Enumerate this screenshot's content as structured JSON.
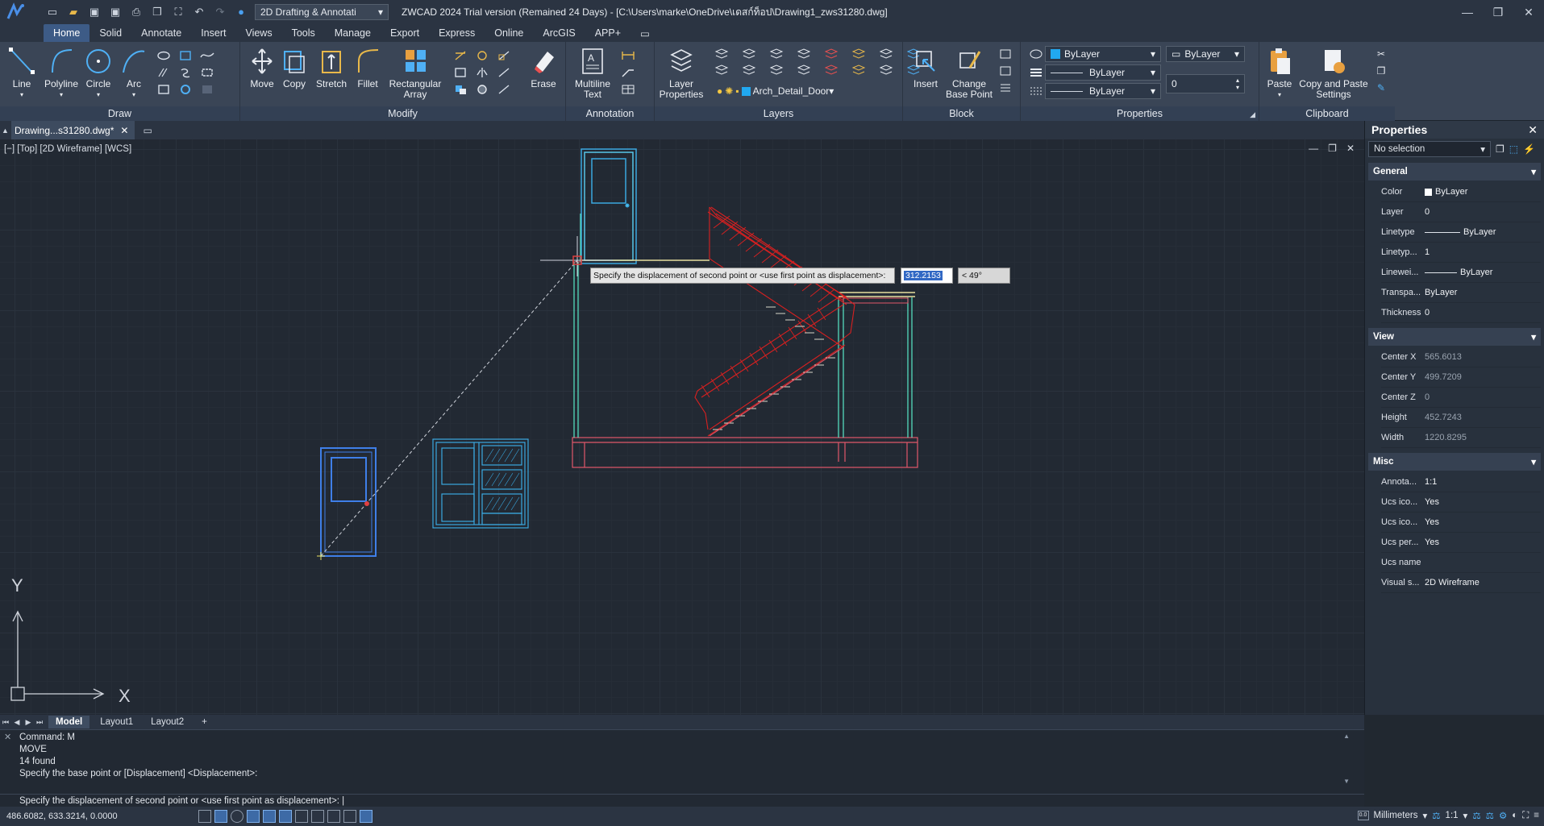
{
  "titlebar": {
    "workspace": "2D Drafting & Annotati",
    "title": "ZWCAD 2024 Trial version (Remained 24 Days) - [C:\\Users\\marke\\OneDrive\\เดสก์ท็อป\\Drawing1_zws31280.dwg]"
  },
  "ribbon_tabs": [
    "Home",
    "Solid",
    "Annotate",
    "Insert",
    "Views",
    "Tools",
    "Manage",
    "Export",
    "Express",
    "Online",
    "ArcGIS",
    "APP+"
  ],
  "ribbon": {
    "draw": {
      "title": "Draw",
      "line": "Line",
      "polyline": "Polyline",
      "circle": "Circle",
      "arc": "Arc"
    },
    "modify": {
      "title": "Modify",
      "move": "Move",
      "copy": "Copy",
      "stretch": "Stretch",
      "fillet": "Fillet",
      "rect_array_1": "Rectangular",
      "rect_array_2": "Array",
      "erase": "Erase"
    },
    "annotation": {
      "title": "Annotation",
      "mtext_1": "Multiline",
      "mtext_2": "Text"
    },
    "layers": {
      "title": "Layers",
      "props_1": "Layer",
      "props_2": "Properties",
      "current_layer": "Arch_Detail_Door"
    },
    "block": {
      "title": "Block",
      "insert": "Insert",
      "change_1": "Change",
      "change_2": "Base Point"
    },
    "properties": {
      "title": "Properties",
      "color": "ByLayer",
      "linetype": "ByLayer",
      "lineweight": "ByLayer",
      "plotstyle": "ByLayer",
      "transparency": "0"
    },
    "clipboard": {
      "title": "Clipboard",
      "paste": "Paste",
      "cps_1": "Copy and Paste",
      "cps_2": "Settings"
    }
  },
  "doc_tab": "Drawing...s31280.dwg*",
  "viewport": {
    "label": "[−] [Top] [2D Wireframe] [WCS]",
    "tooltip": "Specify the displacement of second point or <use first point as displacement>:",
    "distance": "312.2153",
    "angle": "< 49°",
    "ucs_y": "Y",
    "ucs_x": "X"
  },
  "properties_panel": {
    "title": "Properties",
    "selection": "No selection",
    "general": {
      "title": "General",
      "rows": [
        {
          "k": "Color",
          "v": "ByLayer"
        },
        {
          "k": "Layer",
          "v": "0"
        },
        {
          "k": "Linetype",
          "v": "ByLayer"
        },
        {
          "k": "Linetyp...",
          "v": "1"
        },
        {
          "k": "Linewei...",
          "v": "ByLayer"
        },
        {
          "k": "Transpa...",
          "v": "ByLayer"
        },
        {
          "k": "Thickness",
          "v": "0"
        }
      ]
    },
    "view": {
      "title": "View",
      "rows": [
        {
          "k": "Center X",
          "v": "565.6013"
        },
        {
          "k": "Center Y",
          "v": "499.7209"
        },
        {
          "k": "Center Z",
          "v": "0"
        },
        {
          "k": "Height",
          "v": "452.7243"
        },
        {
          "k": "Width",
          "v": "1220.8295"
        }
      ]
    },
    "misc": {
      "title": "Misc",
      "rows": [
        {
          "k": "Annota...",
          "v": "1:1"
        },
        {
          "k": "Ucs ico...",
          "v": "Yes"
        },
        {
          "k": "Ucs ico...",
          "v": "Yes"
        },
        {
          "k": "Ucs per...",
          "v": "Yes"
        },
        {
          "k": "Ucs name",
          "v": ""
        },
        {
          "k": "Visual s...",
          "v": "2D Wireframe"
        }
      ]
    }
  },
  "layout_tabs": [
    "Model",
    "Layout1",
    "Layout2",
    "+"
  ],
  "command": {
    "history": [
      "Command: M",
      "MOVE",
      "14 found",
      "Specify the base point or [Displacement] <Displacement>:"
    ],
    "prompt": "Specify the displacement of second point or <use first point as displacement>: |"
  },
  "status": {
    "coords": "486.6082, 633.3214, 0.0000",
    "units": "Millimeters",
    "scale": "1:1"
  },
  "colors": {
    "accent": "#3d5b86",
    "wall": "#e0586a",
    "door": "#3f7fe8",
    "glass": "#58c6e8",
    "stair": "#d82020"
  }
}
